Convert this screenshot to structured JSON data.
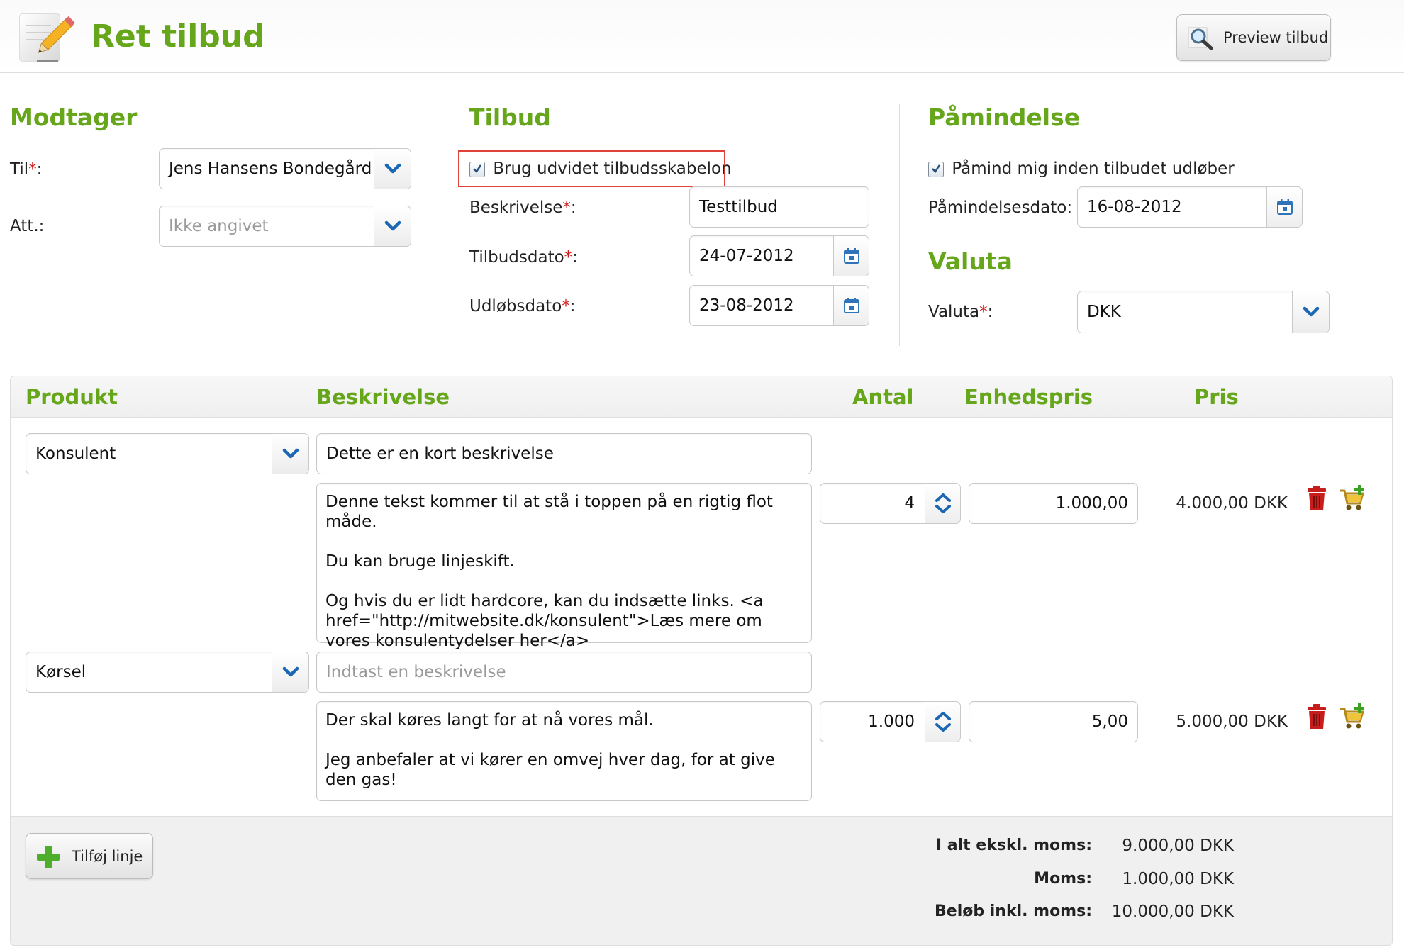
{
  "header": {
    "title": "Ret tilbud",
    "preview_label": "Preview tilbud"
  },
  "modtager": {
    "heading": "Modtager",
    "til_label": "Til",
    "til_value": "Jens Hansens Bondegård",
    "att_label": "Att.:",
    "att_placeholder": "Ikke angivet"
  },
  "tilbud": {
    "heading": "Tilbud",
    "template_checkbox_label": "Brug udvidet tilbudsskabelon",
    "template_checked": true,
    "beskrivelse_label": "Beskrivelse",
    "beskrivelse_value": "Testtilbud",
    "tilbudsdato_label": "Tilbudsdato",
    "tilbudsdato_value": "24-07-2012",
    "udlobsdato_label": "Udløbsdato",
    "udlobsdato_value": "23-08-2012"
  },
  "paamindelse": {
    "heading": "Påmindelse",
    "checkbox_label": "Påmind mig inden tilbudet udløber",
    "checked": true,
    "dato_label": "Påmindelsesdato:",
    "dato_value": "16-08-2012"
  },
  "valuta": {
    "heading": "Valuta",
    "label": "Valuta",
    "value": "DKK"
  },
  "lines_header": {
    "produkt": "Produkt",
    "beskrivelse": "Beskrivelse",
    "antal": "Antal",
    "enhedspris": "Enhedspris",
    "pris": "Pris"
  },
  "lines": [
    {
      "produkt": "Konsulent",
      "kort_beskrivelse": "Dette er en kort beskrivelse",
      "lang_beskrivelse": [
        "Denne tekst kommer til at stå i toppen på en rigtig flot måde.",
        "Du kan bruge linjeskift.",
        "Og hvis du er lidt hardcore, kan du indsætte links. <a href=\"http://mitwebsite.dk/konsulent\">Læs mere om vores konsulentydelser her</a>"
      ],
      "antal": "4",
      "enhedspris": "1.000,00",
      "pris": "4.000,00 DKK"
    },
    {
      "produkt": "Kørsel",
      "kort_beskrivelse_placeholder": "Indtast en beskrivelse",
      "lang_beskrivelse": [
        "Der skal køres langt for at nå vores mål.",
        "Jeg anbefaler at vi kører en omvej hver dag, for at give den gas!"
      ],
      "antal": "1.000",
      "enhedspris": "5,00",
      "pris": "5.000,00 DKK"
    }
  ],
  "footer": {
    "add_line_label": "Tilføj linje",
    "ialt_label": "I alt ekskl. moms:",
    "ialt_value": "9.000,00 DKK",
    "moms_label": "Moms:",
    "moms_value": "1.000,00 DKK",
    "belob_label": "Beløb inkl. moms:",
    "belob_value": "10.000,00 DKK"
  },
  "colors": {
    "accent_green": "#66a61a",
    "required_red": "#d21c1c",
    "highlight_red": "#e0413b",
    "select_arrow_blue": "#1b67b3",
    "delete_red": "#c81d1d"
  }
}
